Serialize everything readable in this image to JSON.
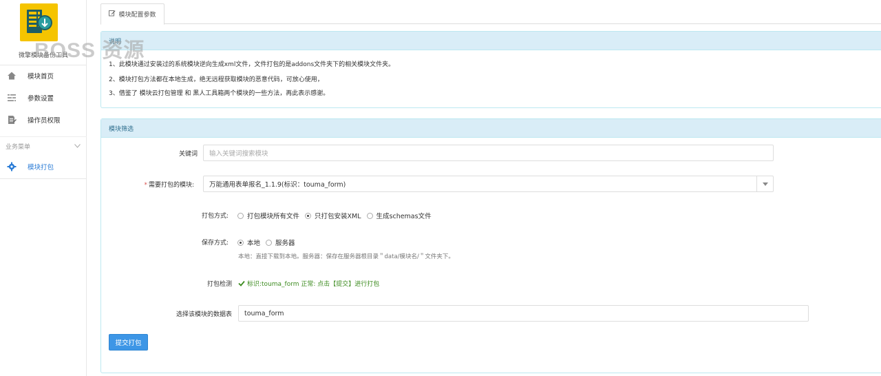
{
  "app": {
    "name": "微擎模块备份工具",
    "watermark": "BOSS 资源"
  },
  "sidebar": {
    "items": [
      {
        "label": "模块首页",
        "icon": "home-icon"
      },
      {
        "label": "参数设置",
        "icon": "list-settings-icon"
      },
      {
        "label": "操作员权限",
        "icon": "document-edit-icon"
      }
    ],
    "section_title": "业务菜单",
    "menu_items": [
      {
        "label": "模块打包",
        "icon": "gear-icon",
        "active": true
      }
    ]
  },
  "tab": {
    "label": "模块配置参数",
    "icon": "edit-icon"
  },
  "notes": {
    "title": "说明",
    "lines": [
      "1、此模块通过安装过的系统模块逆向生成xml文件，文件打包的是addons文件夹下的相关模块文件夹。",
      "2、模块打包方法都在本地生成，绝无远程获取模块的恶意代码，可放心使用，",
      "3、借鉴了 模块云打包管理 和 黑人工具箱两个模块的一些方法，再此表示感谢。"
    ]
  },
  "filter": {
    "title": "模块筛选",
    "keyword": {
      "label": "关键词",
      "placeholder": "输入关键词搜索模块"
    },
    "module": {
      "required_mark": "*",
      "label": "需要打包的模块:",
      "value": "万能通用表单报名_1.1.9(标识：touma_form)"
    },
    "pack_mode": {
      "label": "打包方式:",
      "options": [
        {
          "label": "打包模块所有文件",
          "checked": false
        },
        {
          "label": "只打包安装XML",
          "checked": true
        },
        {
          "label": "生成schemas文件",
          "checked": false
        }
      ]
    },
    "save_mode": {
      "label": "保存方式:",
      "options": [
        {
          "label": "本地",
          "checked": true
        },
        {
          "label": "服务器",
          "checked": false
        }
      ],
      "help": "本地：直接下载到本地。服务器：保存在服务器根目录＂data/模块名/＂文件夹下。"
    },
    "pack_check": {
      "label": "打包检测",
      "message": "标识:touma_form 正常: 点击【提交】进行打包"
    },
    "tables": {
      "label": "选择该模块的数据表",
      "value": "touma_form"
    },
    "submit_label": "提交打包"
  },
  "colors": {
    "accent": "#3d96e6",
    "panel_head": "#d9edf7",
    "panel_border": "#bce8f1",
    "success": "#3c8b1f",
    "required": "#d9534f",
    "logo_bg": "#f5c400"
  }
}
